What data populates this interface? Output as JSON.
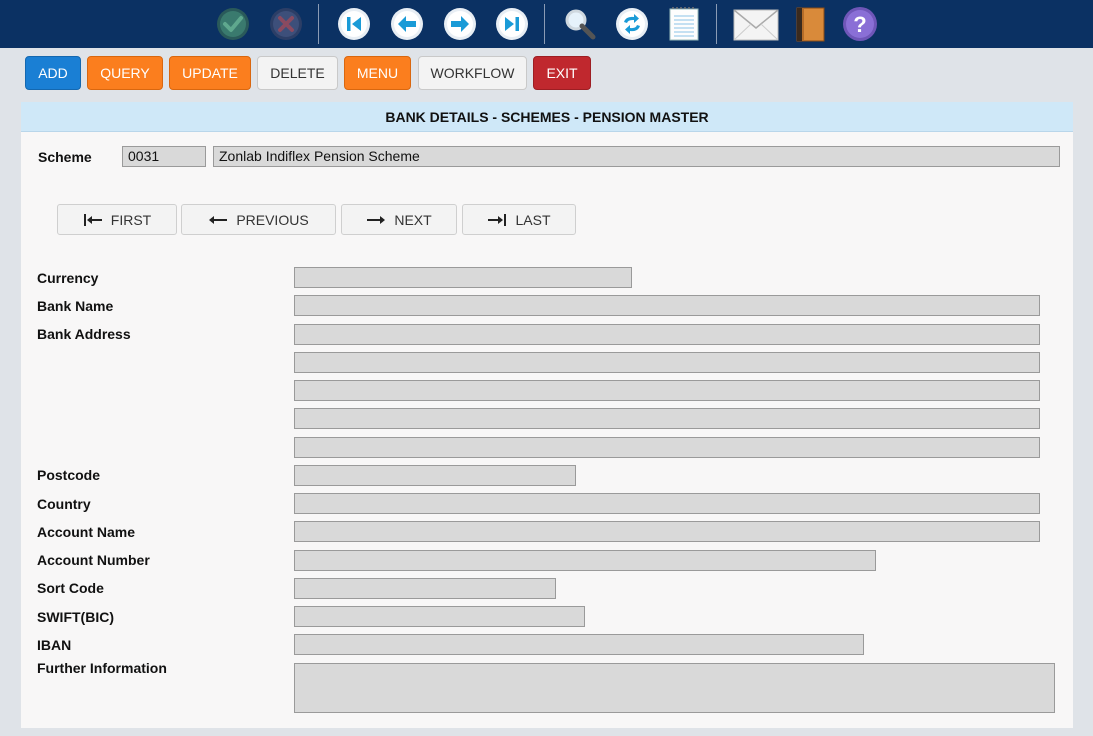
{
  "toolbar": {
    "icons": [
      "check-icon",
      "cancel-icon",
      "first-record-icon",
      "previous-record-icon",
      "next-record-icon",
      "last-record-icon",
      "search-icon",
      "refresh-icon",
      "notepad-icon",
      "mail-icon",
      "book-icon",
      "help-icon"
    ],
    "colors": {
      "background": "#0b3163",
      "accent": "#1a9bd7"
    }
  },
  "actions": {
    "add": "ADD",
    "query": "QUERY",
    "update": "UPDATE",
    "delete": "DELETE",
    "menu": "MENU",
    "workflow": "WORKFLOW",
    "exit": "EXIT",
    "colors": {
      "blue": "#1a7fd4",
      "orange": "#fb7e1e",
      "red": "#c0282e"
    }
  },
  "panel": {
    "title": "BANK DETAILS - SCHEMES - PENSION MASTER"
  },
  "scheme": {
    "label": "Scheme",
    "code": "0031",
    "name": "Zonlab Indiflex Pension Scheme"
  },
  "nav": {
    "first": "FIRST",
    "previous": "PREVIOUS",
    "next": "NEXT",
    "last": "LAST"
  },
  "form": {
    "currency": {
      "label": "Currency",
      "value": ""
    },
    "bank_name": {
      "label": "Bank Name",
      "value": ""
    },
    "bank_address": {
      "label": "Bank Address",
      "lines": [
        "",
        "",
        "",
        "",
        ""
      ]
    },
    "postcode": {
      "label": "Postcode",
      "value": ""
    },
    "country": {
      "label": "Country",
      "value": ""
    },
    "account_name": {
      "label": "Account Name",
      "value": ""
    },
    "account_number": {
      "label": "Account Number",
      "value": ""
    },
    "sort_code": {
      "label": "Sort Code",
      "value": ""
    },
    "swift": {
      "label": "SWIFT(BIC)",
      "value": ""
    },
    "iban": {
      "label": "IBAN",
      "value": ""
    },
    "further_info": {
      "label": "Further Information",
      "value": ""
    }
  }
}
